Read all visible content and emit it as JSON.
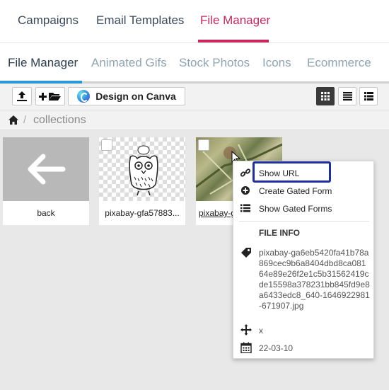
{
  "top_nav": {
    "tabs": [
      {
        "label": "Campaigns"
      },
      {
        "label": "Email Templates"
      },
      {
        "label": "File Manager"
      }
    ],
    "active": "File Manager",
    "accent_color": "#c8285e"
  },
  "sub_nav": {
    "tabs": [
      {
        "label": "File Manager"
      },
      {
        "label": "Animated Gifs"
      },
      {
        "label": "Stock Photos"
      },
      {
        "label": "Icons"
      },
      {
        "label": "Ecommerce"
      }
    ],
    "active": "File Manager",
    "accent_color": "#2a98d4"
  },
  "toolbar": {
    "upload_icon": "upload-icon",
    "new_folder_icon": "new-folder-icon",
    "canva_label": "Design on Canva",
    "views": [
      "grid-large-view",
      "list-view",
      "grid-small-view"
    ],
    "active_view": "grid-large-view"
  },
  "breadcrumb": {
    "home_icon": "home-icon",
    "separator": "/",
    "current": "collections"
  },
  "files": [
    {
      "name": "back",
      "type": "back"
    },
    {
      "name": "pixabay-gfa57883...",
      "type": "image"
    },
    {
      "name": "pixabay-g",
      "type": "image"
    }
  ],
  "context_menu": {
    "items": [
      {
        "label": "Show URL",
        "icon": "link-icon"
      },
      {
        "label": "Create Gated Form",
        "icon": "plus-circle-icon"
      },
      {
        "label": "Show Gated Forms",
        "icon": "list-icon"
      }
    ],
    "highlighted": "Show URL",
    "highlight_color": "#1f2f9f",
    "file_info": {
      "heading": "FILE INFO",
      "filename": "pixabay-ga6eb5420fa41b78a869cec9b6a8404dbd8ca08164e89e26f2e1c5b31562419cde15598a378231bb845fd9e8a6433edc8_640-1646922981-671907.jpg",
      "dimensions": "x",
      "date": "22-03-10"
    }
  }
}
